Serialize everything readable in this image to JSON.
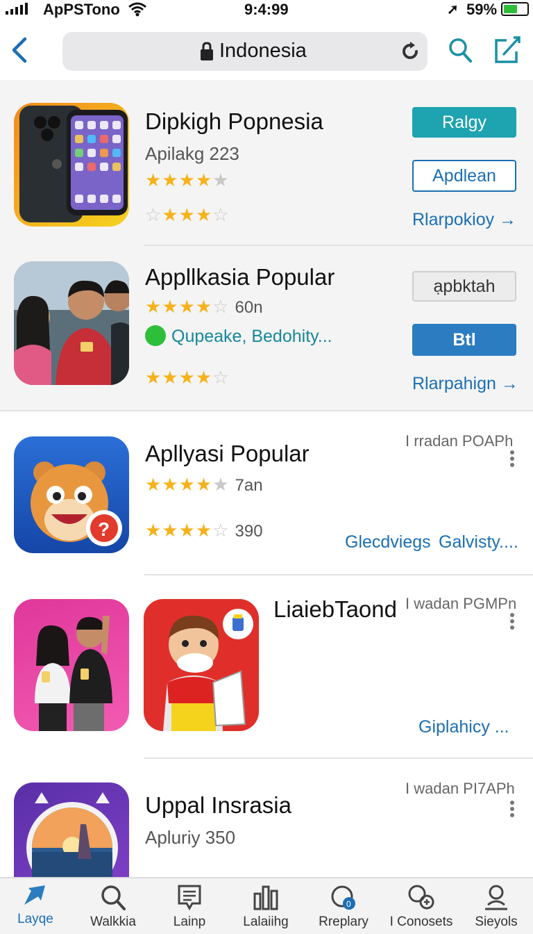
{
  "status_bar": {
    "carrier": "ApPSTono",
    "time": "9:4:99",
    "battery": "59%",
    "battery_level": 0.59
  },
  "nav": {
    "url": "Indonesia"
  },
  "rows": [
    {
      "title": "Dipkigh Popnesia",
      "subtitle": "Apilakg 223",
      "primary_button": "Ralgy",
      "secondary_button": "Apdlean",
      "link": "Rlarpokioy →"
    },
    {
      "title": "Appllkasia Popular",
      "rating_count": "60n",
      "whatsapp_text": "Qupeake, Bedohity...",
      "secondary_button": "ạpbktah",
      "primary_button": "Btl",
      "link": "Rlarpahign →"
    },
    {
      "title": "Apllyasi Popular",
      "meta": "I rradan POAPh",
      "rating_count_1": "7an",
      "rating_count_2": "390",
      "link_1": "Glecdviegs",
      "link_2": "Galvisty...."
    },
    {
      "title": "LiaiebTaond",
      "meta": "I wadan PGMPn",
      "link": "Giplahicy ..."
    },
    {
      "title": "Uppal Insrasia",
      "subtitle": "Apluriy 350",
      "meta": "I wadan PI7APh"
    }
  ],
  "tabs": [
    {
      "label": "Layqe",
      "icon": "arrow-icon"
    },
    {
      "label": "Walkkia",
      "icon": "search-icon"
    },
    {
      "label": "Lainp",
      "icon": "document-icon"
    },
    {
      "label": "Lalaiihg",
      "icon": "chart-icon"
    },
    {
      "label": "Rreplary",
      "icon": "updates-icon"
    },
    {
      "label": "I Conosets",
      "icon": "apps-icon"
    },
    {
      "label": "Sieyols",
      "icon": "profile-icon"
    }
  ],
  "colors": {
    "accent_blue": "#1b6fb3",
    "teal": "#1ea3b0",
    "star": "#f5b21b"
  }
}
